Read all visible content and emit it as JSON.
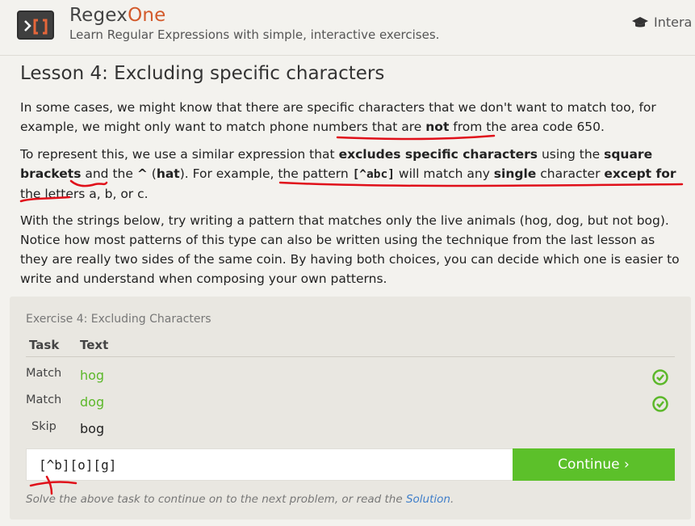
{
  "header": {
    "brand_main": "Regex",
    "brand_accent": "One",
    "tagline": "Learn Regular Expressions with simple, interactive exercises.",
    "nav_label": "Intera",
    "logo_icon": "terminal-brackets-icon",
    "nav_icon": "graduation-cap-icon"
  },
  "lesson": {
    "title": "Lesson 4: Excluding specific characters",
    "p1": {
      "a": "In some cases, we might know that there are specific characters that we don't want to match too, for example, we might only want to match phone numbers that are ",
      "b": "not",
      "c": " from the area code 650."
    },
    "p2": {
      "a": "To represent this, we use a similar expression that ",
      "b": "excludes specific characters",
      "c": " using the ",
      "d": "square brackets",
      "e": " and the ",
      "f": "^",
      "g": " (",
      "h": "hat",
      "i": "). For example, the pattern ",
      "j": "[^abc]",
      "k": " will match any ",
      "l": "single",
      "m": " character ",
      "n": "except for",
      "o": " the letters a, b, or c."
    },
    "p3": "With the strings below, try writing a pattern that matches only the live animals (hog, dog, but not bog). Notice how most patterns of this type can also be written using the technique from the last lesson as they are really two sides of the same coin. By having both choices, you can decide which one is easier to write and understand when composing your own patterns."
  },
  "exercise": {
    "title": "Exercise 4: Excluding Characters",
    "col_task": "Task",
    "col_text": "Text",
    "rows": [
      {
        "task": "Match",
        "text": "hog",
        "status": "check-circle-icon"
      },
      {
        "task": "Match",
        "text": "dog",
        "status": "check-circle-icon"
      },
      {
        "task": "Skip",
        "text": "bog",
        "status": ""
      }
    ],
    "input_value": "[^b][o][g]",
    "continue_label": "Continue ›",
    "hint_prefix": "Solve the above task to continue on to the next problem, or read the ",
    "hint_link": "Solution",
    "hint_suffix": "."
  },
  "colors": {
    "accent": "#d35a2b",
    "success": "#5cb82a",
    "button": "#5cc02a",
    "link": "#3f7ec9",
    "annotation": "#e0101a"
  }
}
